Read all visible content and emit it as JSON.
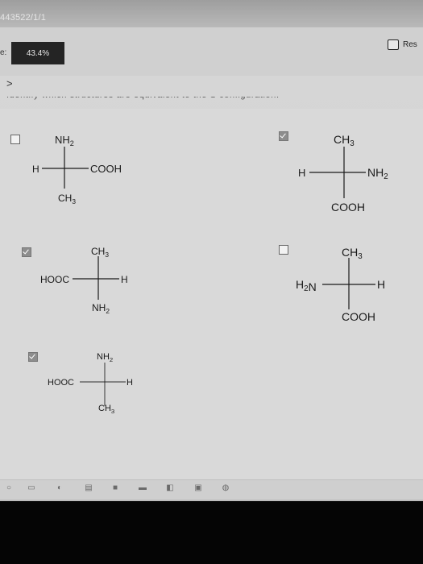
{
  "browser": {
    "url_fragment": "443522/1/1"
  },
  "header": {
    "left_label": "e:",
    "score": "43.4%",
    "reset_label": "Res"
  },
  "nav": {
    "chevron": ">"
  },
  "options": [
    {
      "checked": false,
      "top": "NH2",
      "bottom": "CH3",
      "left": "H",
      "right": "COOH"
    },
    {
      "checked": true,
      "top": "CH3",
      "bottom": "COOH",
      "left": "H",
      "right": "NH2"
    },
    {
      "checked": true,
      "top": "CH3",
      "bottom": "NH2",
      "left": "HOOC",
      "right": "H"
    },
    {
      "checked": false,
      "top": "CH3",
      "bottom": "COOH",
      "left": "H2N",
      "right": "H"
    },
    {
      "checked": true,
      "top": "NH2",
      "bottom": "CH3",
      "left": "HOOC",
      "right": "H"
    }
  ],
  "icons": {
    "taskbar": [
      "start-circle-icon",
      "task-view-icon",
      "browser-icon",
      "files-icon",
      "store-icon",
      "mail-icon",
      "word-icon",
      "media-icon",
      "chrome-icon"
    ]
  }
}
